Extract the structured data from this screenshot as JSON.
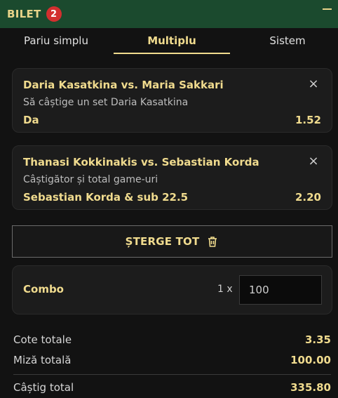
{
  "header": {
    "title": "BILET",
    "badge_count": "2",
    "collapse_icon": "minus-icon"
  },
  "tabs": [
    {
      "label": "Pariu simplu",
      "active": false
    },
    {
      "label": "Multiplu",
      "active": true
    },
    {
      "label": "Sistem",
      "active": false
    }
  ],
  "bets": [
    {
      "match": "Daria Kasatkina vs. Maria Sakkari",
      "market": "Să câștige un set Daria Kasatkina",
      "selection": "Da",
      "odds": "1.52"
    },
    {
      "match": "Thanasi Kokkinakis vs. Sebastian Korda",
      "market": "Câștigător și total game-uri",
      "selection": "Sebastian Korda & sub 22.5",
      "odds": "2.20"
    }
  ],
  "clear_all": {
    "label": "ȘTERGE TOT",
    "icon": "trash-icon"
  },
  "combo": {
    "label": "Combo",
    "multiplier": "1 x",
    "stake_value": "100"
  },
  "summary": {
    "total_odds_label": "Cote totale",
    "total_odds_value": "3.35",
    "total_stake_label": "Miză totală",
    "total_stake_value": "100.00",
    "total_win_label": "Câștig total",
    "total_win_value": "335.80"
  },
  "colors": {
    "header_bg": "#1b4a2e",
    "accent_gold": "#f0db8e",
    "badge_red": "#d32f2f",
    "card_bg": "#1c1c1c",
    "page_bg": "#121212"
  }
}
